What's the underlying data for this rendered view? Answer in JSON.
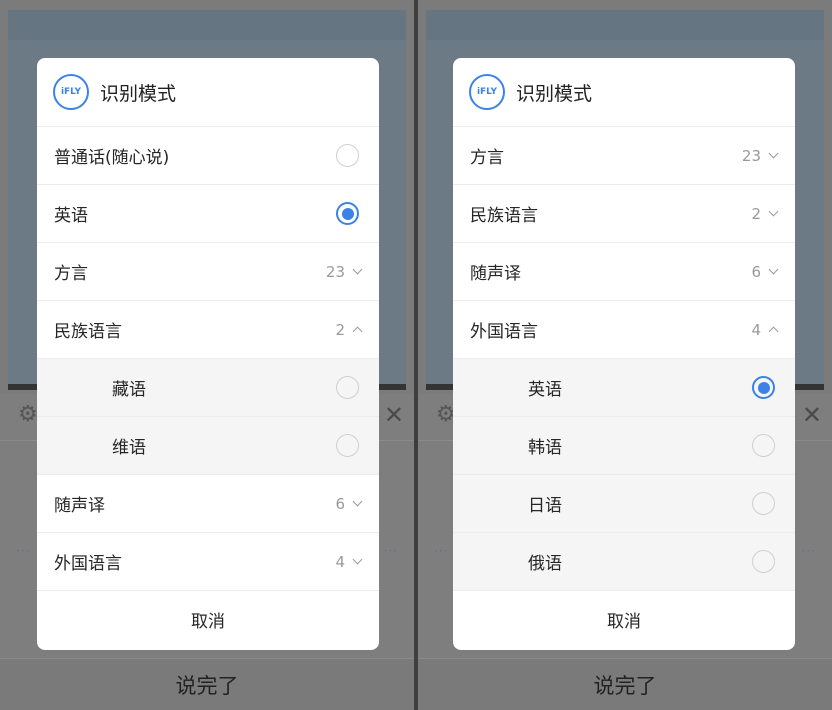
{
  "colors": {
    "accent": "#3c82e6"
  },
  "left": {
    "dialog": {
      "logo_text": "iFLY",
      "title": "识别模式",
      "cancel": "取消",
      "rows": [
        {
          "label": "普通话(随心说)",
          "kind": "radio",
          "selected": false
        },
        {
          "label": "英语",
          "kind": "radio",
          "selected": true
        },
        {
          "label": "方言",
          "kind": "group",
          "count": "23",
          "expanded": false
        },
        {
          "label": "民族语言",
          "kind": "group",
          "count": "2",
          "expanded": true
        },
        {
          "label": "藏语",
          "kind": "subradio",
          "selected": false
        },
        {
          "label": "维语",
          "kind": "subradio",
          "selected": false
        },
        {
          "label": "随声译",
          "kind": "group",
          "count": "6",
          "expanded": false
        },
        {
          "label": "外国语言",
          "kind": "group",
          "count": "4",
          "expanded": false
        }
      ]
    },
    "bottom_label": "说完了"
  },
  "right": {
    "dialog": {
      "logo_text": "iFLY",
      "title": "识别模式",
      "cancel": "取消",
      "rows": [
        {
          "label": "方言",
          "kind": "group",
          "count": "23",
          "expanded": false
        },
        {
          "label": "民族语言",
          "kind": "group",
          "count": "2",
          "expanded": false
        },
        {
          "label": "随声译",
          "kind": "group",
          "count": "6",
          "expanded": false
        },
        {
          "label": "外国语言",
          "kind": "group",
          "count": "4",
          "expanded": true
        },
        {
          "label": "英语",
          "kind": "subradio",
          "selected": true
        },
        {
          "label": "韩语",
          "kind": "subradio",
          "selected": false
        },
        {
          "label": "日语",
          "kind": "subradio",
          "selected": false
        },
        {
          "label": "俄语",
          "kind": "subradio",
          "selected": false
        }
      ]
    },
    "bottom_label": "说完了"
  },
  "icons": {
    "settings": "gear-icon",
    "close": "close-icon",
    "radio": "radio-icon",
    "chevron_up": "chevron-up-icon",
    "chevron_down": "chevron-down-icon"
  }
}
